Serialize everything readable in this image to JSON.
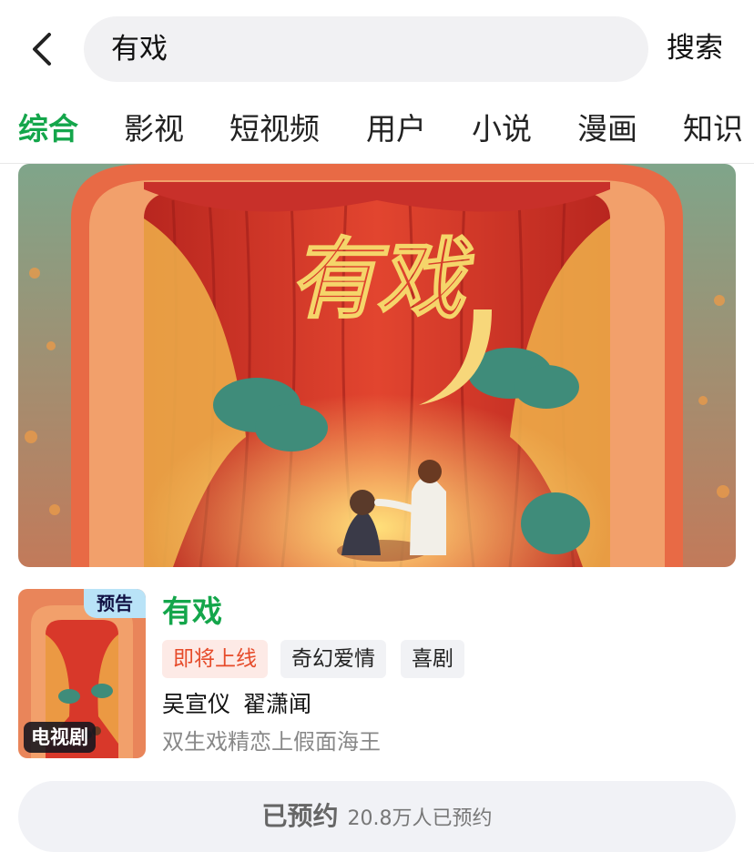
{
  "header": {
    "back_icon": "chevron-left-icon",
    "search_query": "有戏",
    "search_button": "搜索"
  },
  "tabs": [
    {
      "label": "综合",
      "active": true
    },
    {
      "label": "影视",
      "active": false
    },
    {
      "label": "短视频",
      "active": false
    },
    {
      "label": "用户",
      "active": false
    },
    {
      "label": "小说",
      "active": false
    },
    {
      "label": "漫画",
      "active": false
    },
    {
      "label": "知识",
      "active": false
    }
  ],
  "banner": {
    "title_art": "有戏"
  },
  "result": {
    "title": "有戏",
    "badge": "预告",
    "type_label": "电视剧",
    "tags": {
      "status": "即将上线",
      "genre1": "奇幻爱情",
      "genre2": "喜剧"
    },
    "cast": [
      "吴宣仪",
      "翟潇闻"
    ],
    "description": "双生戏精恋上假面海王",
    "reserve": {
      "status": "已预约",
      "count": "20.8万人已预约"
    }
  },
  "colors": {
    "accent_green": "#14a64b",
    "upcoming_red": "#e64b2a",
    "curtain_red": "#d63a2a"
  }
}
